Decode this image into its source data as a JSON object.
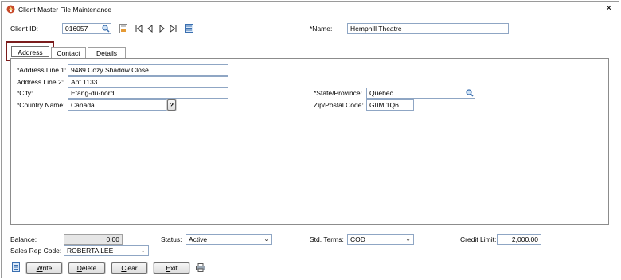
{
  "window": {
    "title": "Client Master File Maintenance",
    "close_glyph": "×"
  },
  "header": {
    "client_id_label": "Client ID:",
    "client_id_value": "016057",
    "name_label": "*Name:",
    "name_value": "Hemphill Theatre"
  },
  "tabs": [
    {
      "label": "Address",
      "active": true
    },
    {
      "label": "Contact",
      "active": false
    },
    {
      "label": "Details",
      "active": false
    }
  ],
  "address": {
    "line1_label": "*Address Line 1:",
    "line1_value": "9489 Cozy Shadow Close",
    "line2_label": "Address Line 2:",
    "line2_value": "Apt 1133",
    "city_label": "*City:",
    "city_value": "Etang-du-nord",
    "country_label": "*Country Name:",
    "country_value": "Canada",
    "country_help": "?",
    "state_label": "*State/Province:",
    "state_value": "Quebec",
    "zip_label": "Zip/Postal Code:",
    "zip_value": "G0M 1Q6"
  },
  "footer": {
    "balance_label": "Balance:",
    "balance_value": "0.00",
    "status_label": "Status:",
    "status_value": "Active",
    "terms_label": "Std. Terms:",
    "terms_value": "COD",
    "credit_label": "Credit Limit:",
    "credit_value": "2,000.00",
    "sales_rep_label": "Sales Rep Code:",
    "sales_rep_value": "ROBERTA LEE"
  },
  "buttons": {
    "write_u": "W",
    "write_rest": "rite",
    "delete_u": "D",
    "delete_rest": "elete",
    "clear_u": "C",
    "clear_rest": "lear",
    "exit_u": "E",
    "exit_rest": "xit"
  },
  "colors": {
    "highlight": "#7b1c1c",
    "field_border": "#8fa6c4",
    "icon_blue": "#3a6fb0"
  }
}
